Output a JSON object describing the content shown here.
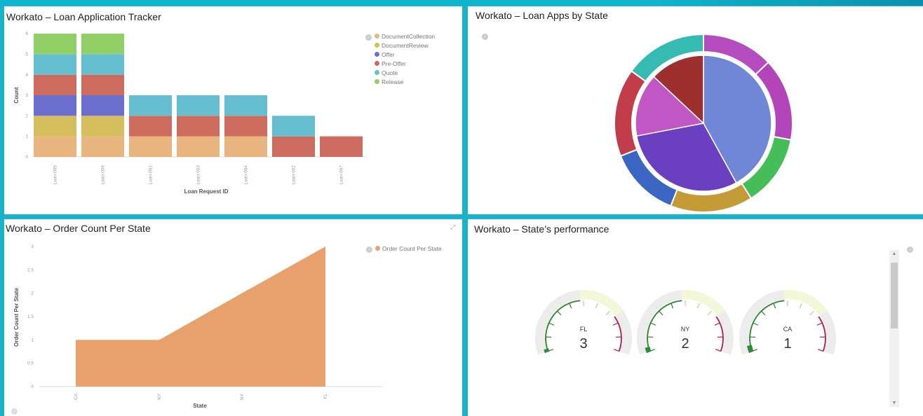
{
  "panels": {
    "tracker": {
      "title": "Workato – Loan Application Tracker"
    },
    "by_state": {
      "title": "Workato – Loan Apps by State"
    },
    "order_count": {
      "title": "Workato – Order Count Per State"
    },
    "performance": {
      "title": "Workato – State’s performance"
    }
  },
  "chart_data": [
    {
      "type": "bar",
      "stacked": true,
      "xlabel": "Loan Request ID",
      "ylabel": "Count",
      "ylim": [
        0,
        6
      ],
      "yticks": [
        0,
        1,
        2,
        3,
        4,
        5,
        6
      ],
      "categories": [
        "Loan-005",
        "Loan-006",
        "Loan-001",
        "Loan-003",
        "Loan-004",
        "Loan-002",
        "Loan-007"
      ],
      "legend_position": "top-right",
      "series": [
        {
          "name": "DocumentCollection",
          "color": "#e8b57e",
          "values": [
            1,
            1,
            1,
            1,
            1,
            0,
            0
          ]
        },
        {
          "name": "DocumentReview",
          "color": "#d4bf5c",
          "values": [
            1,
            1,
            0,
            0,
            0,
            0,
            0
          ]
        },
        {
          "name": "Offer",
          "color": "#6d6fcf",
          "values": [
            1,
            1,
            0,
            0,
            0,
            0,
            0
          ]
        },
        {
          "name": "Pre-Offer",
          "color": "#cc6b5e",
          "values": [
            1,
            1,
            1,
            1,
            1,
            1,
            1
          ]
        },
        {
          "name": "Quote",
          "color": "#66bfd1",
          "values": [
            1,
            1,
            1,
            1,
            1,
            1,
            0
          ]
        },
        {
          "name": "Release",
          "color": "#8fcf66",
          "values": [
            1,
            1,
            0,
            0,
            0,
            0,
            0
          ]
        }
      ]
    },
    {
      "type": "pie",
      "subtype": "nested-donut",
      "inner": [
        {
          "value": 42,
          "color": "#6f87d6"
        },
        {
          "value": 30,
          "color": "#6a3fc0"
        },
        {
          "value": 15,
          "color": "#c057c4"
        },
        {
          "value": 13,
          "color": "#9e2f2f"
        }
      ],
      "outer": [
        {
          "value": 13,
          "color": "#b44cbf"
        },
        {
          "value": 15,
          "color": "#b444b9"
        },
        {
          "value": 13,
          "color": "#45be5a"
        },
        {
          "value": 15,
          "color": "#c59b38"
        },
        {
          "value": 13,
          "color": "#3c66c4"
        },
        {
          "value": 16,
          "color": "#c23c4b"
        },
        {
          "value": 15,
          "color": "#35bbb1"
        }
      ]
    },
    {
      "type": "area",
      "xlabel": "State",
      "ylabel": "Order Count Per State",
      "ylim": [
        0,
        3
      ],
      "yticks": [
        "0",
        "0.5",
        "1",
        "1.5",
        "2",
        "2.5",
        "3"
      ],
      "categories": [
        "CA",
        "NY",
        "NY",
        "FL"
      ],
      "legend_position": "top-right",
      "series": [
        {
          "name": "Order Count Per State",
          "color": "#e8a06c",
          "values": [
            1,
            1,
            2,
            3
          ]
        }
      ]
    },
    {
      "type": "gauge",
      "max": 3,
      "items": [
        {
          "label": "FL",
          "value": 3
        },
        {
          "label": "NY",
          "value": 2
        },
        {
          "label": "CA",
          "value": 1
        }
      ]
    }
  ]
}
